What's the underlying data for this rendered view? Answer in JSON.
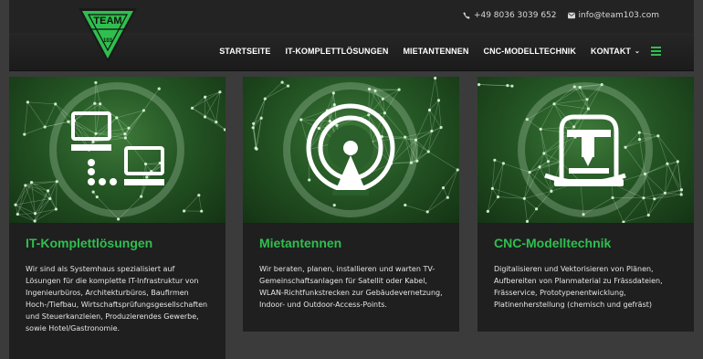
{
  "logo": {
    "text": "TEAM",
    "number": "103"
  },
  "contact": {
    "phone": "+49 8036 3039 652",
    "email": "info@team103.com"
  },
  "nav": {
    "items": [
      {
        "label": "STARTSEITE"
      },
      {
        "label": "IT-KOMPLETTLÖSUNGEN"
      },
      {
        "label": "MIETANTENNEN"
      },
      {
        "label": "CNC-MODELLTECHNIK"
      },
      {
        "label": "KONTAKT"
      }
    ],
    "accent": "#2fbf4f"
  },
  "cards": [
    {
      "icon": "computer-network-icon",
      "title": "IT-Komplettlösungen",
      "text": "Wir sind als Systemhaus spezialisiert auf Lösungen für die komplette IT-Infrastruktur von Ingenieurbüros, Architekturbüros, Baufirmen Hoch-/Tiefbau, Wirtschaftsprüfungsgesellschaften und Steuerkanzleien, Produzierendes Gewerbe, sowie Hotel/Gastronomie."
    },
    {
      "icon": "antenna-broadcast-icon",
      "title": "Mietantennen",
      "text": "Wir beraten, planen, installieren und warten TV-Gemeinschaftsanlagen für Satellit oder Kabel, WLAN-Richtfunkstrecken zur Gebäudevernetzung, Indoor- und Outdoor-Access-Points."
    },
    {
      "icon": "cnc-machine-icon",
      "title": "CNC-Modelltechnik",
      "text": "Digitalisieren und Vektorisieren von Plänen, Aufbereiten von Planmaterial zu Frässdateien, Frässervice, Prototypenentwicklung, Platinenherstellung (chemisch und gefräst)"
    }
  ]
}
